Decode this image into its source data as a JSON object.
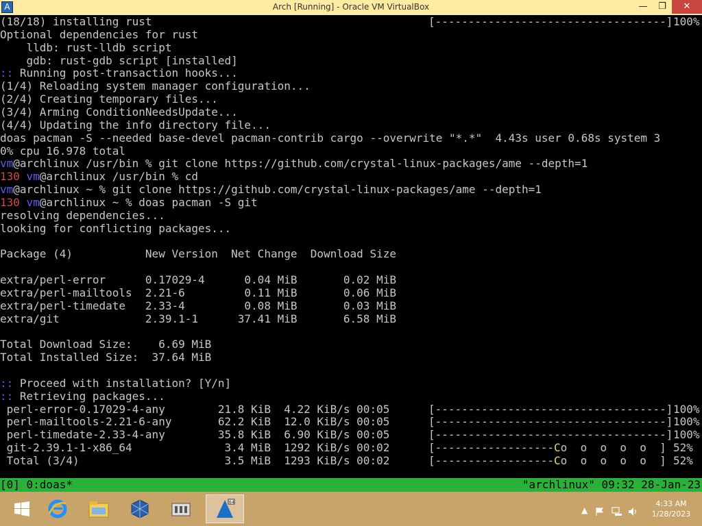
{
  "window": {
    "title": "Arch [Running] - Oracle VM VirtualBox",
    "min_glyph": "—",
    "max_glyph": "❐",
    "close_glyph": "✕"
  },
  "terminal": {
    "lines": [
      {
        "text": "(18/18) installing rust"
      },
      {
        "text": "Optional dependencies for rust"
      },
      {
        "text": "    lldb: rust-lldb script"
      },
      {
        "text": "    gdb: rust-gdb script [installed]"
      },
      {
        "prefix": "::",
        "text": " Running post-transaction hooks..."
      },
      {
        "text": "(1/4) Reloading system manager configuration..."
      },
      {
        "text": "(2/4) Creating temporary files..."
      },
      {
        "text": "(3/4) Arming ConditionNeedsUpdate..."
      },
      {
        "text": "(4/4) Updating the info directory file..."
      },
      {
        "text": "doas pacman -S --needed base-devel pacman-contrib cargo --overwrite \"*.*\"  4.43s user 0.68s system 3"
      },
      {
        "text": "0% cpu 16.978 total"
      },
      {
        "code": "",
        "user": "vm",
        "host": "@archlinux",
        "text": " /usr/bin % git clone https://github.com/crystal-linux-packages/ame --depth=1"
      },
      {
        "code": "130 ",
        "user": "vm",
        "host": "@archlinux",
        "text": " /usr/bin % cd"
      },
      {
        "code": "",
        "user": "vm",
        "host": "@archlinux",
        "text": " ~ % git clone https://github.com/crystal-linux-packages/ame --depth=1"
      },
      {
        "code": "130 ",
        "user": "vm",
        "host": "@archlinux",
        "text": " ~ % doas pacman -S git"
      },
      {
        "text": "resolving dependencies..."
      },
      {
        "text": "looking for conflicting packages..."
      },
      {
        "text": ""
      },
      {
        "text": "Package (4)           New Version  Net Change  Download Size"
      },
      {
        "text": ""
      },
      {
        "text": "extra/perl-error      0.17029-4      0.04 MiB       0.02 MiB"
      },
      {
        "text": "extra/perl-mailtools  2.21-6         0.11 MiB       0.06 MiB"
      },
      {
        "text": "extra/perl-timedate   2.33-4         0.08 MiB       0.03 MiB"
      },
      {
        "text": "extra/git             2.39.1-1      37.41 MiB       6.58 MiB"
      },
      {
        "text": ""
      },
      {
        "text": "Total Download Size:    6.69 MiB"
      },
      {
        "text": "Total Installed Size:  37.64 MiB"
      },
      {
        "text": ""
      },
      {
        "prefix": "::",
        "text": " Proceed with installation? [Y/n]"
      },
      {
        "prefix": "::",
        "text": " Retrieving packages..."
      },
      {
        "text": " perl-error-0.17029-4-any        21.8 KiB  4.22 KiB/s 00:05"
      },
      {
        "text": " perl-mailtools-2.21-6-any       62.2 KiB  12.0 KiB/s 00:05"
      },
      {
        "text": " perl-timedate-2.33-4-any        35.8 KiB  6.90 KiB/s 00:05"
      },
      {
        "text": " git-2.39.1-1-x86_64              3.4 MiB  1292 KiB/s 00:02"
      },
      {
        "text": " Total (3/4)                      3.5 MiB  1293 KiB/s 00:02"
      }
    ],
    "top_progress": {
      "bar": "[-----------------------------------]",
      "percent": "100%"
    },
    "download_progress": [
      {
        "bar": "[-----------------------------------]",
        "percent": "100%"
      },
      {
        "bar": "[-----------------------------------]",
        "percent": "100%"
      },
      {
        "bar": "[-----------------------------------]",
        "percent": "100%"
      },
      {
        "bar_done": "[------------------",
        "pac": "C",
        "bar_rest": "o  o  o  o  o  ]",
        "percent": "52%"
      },
      {
        "bar_done": "[------------------",
        "pac": "C",
        "bar_rest": "o  o  o  o  o  ]",
        "percent": "52%"
      }
    ]
  },
  "tmux": {
    "left": "[0] 0:doas*",
    "right": "\"archlinux\" 09:32 28-Jan-23"
  },
  "taskbar": {
    "start_icon": "windows-logo-icon",
    "items": [
      "internet-explorer-icon",
      "file-explorer-icon",
      "virtualbox-icon",
      "storage-icon",
      "arch-vm-icon"
    ],
    "tray_expand": "▲",
    "tray_icons": [
      "flag-icon",
      "network-icon",
      "volume-icon"
    ],
    "clock_time": "4:33 AM",
    "clock_date": "1/28/2023",
    "colors": {
      "taskbar": "#c9a46a",
      "statusbar": "#29b13a"
    }
  }
}
